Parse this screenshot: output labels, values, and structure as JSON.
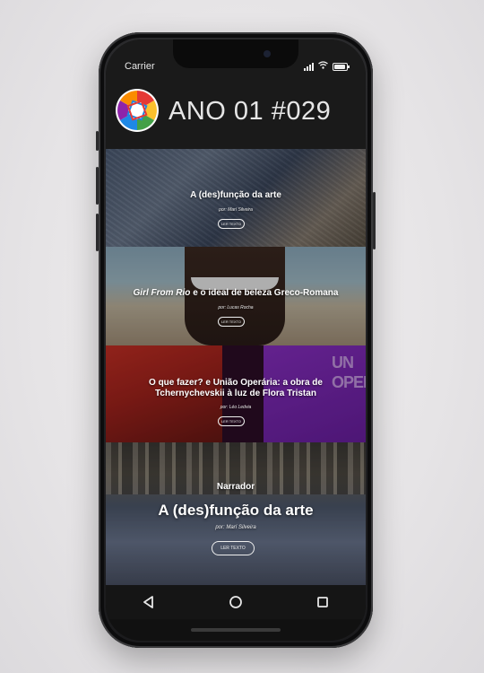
{
  "status_bar": {
    "carrier": "Carrier"
  },
  "header": {
    "issue_title": "ANO 01 #029"
  },
  "articles": [
    {
      "title": "A (des)função da arte",
      "author": "por: Marí Silveira",
      "button": "LER TEXTO"
    },
    {
      "title_italic": "Girl From Rio",
      "title_rest": " e o ideal de beleza Greco-Romana",
      "author": "por: Lucas Rocha",
      "button": "LER TEXTO"
    },
    {
      "title": "O que fazer? e União Operária: a obra de Tchernychevskii à luz de Flora Tristan",
      "author": "por: Léo Ledvia",
      "button": "LER TEXTO",
      "poster_text": "UN\nOPERA"
    }
  ],
  "featured": {
    "section": "Narrador",
    "title": "A (des)função da arte",
    "author": "por: Marí Silveira",
    "button": "LER TEXTO"
  },
  "nav": {
    "back": "back-icon",
    "home": "home-icon",
    "recents": "recents-icon"
  },
  "colors": {
    "bar": "#1a1a1a",
    "text": "#e6e6e6"
  }
}
